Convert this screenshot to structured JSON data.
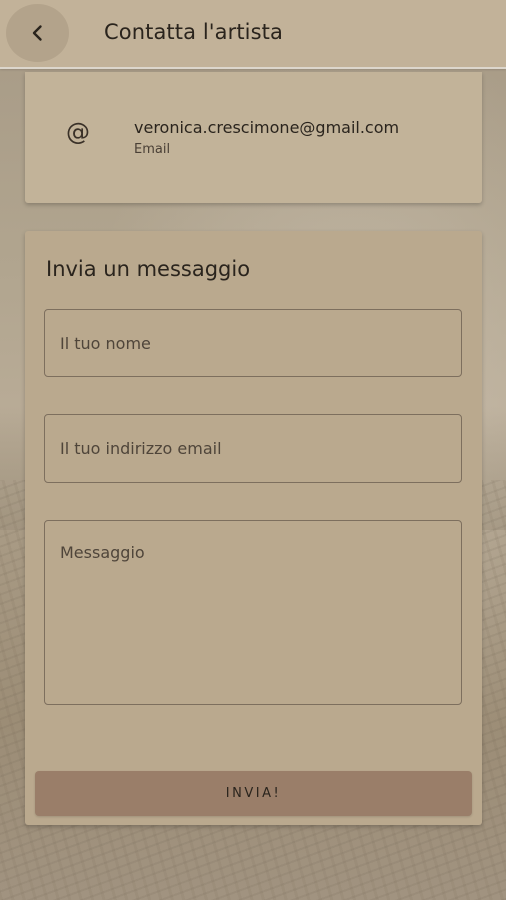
{
  "appbar": {
    "title": "Contatta l'artista",
    "back_icon": "chevron-left-icon"
  },
  "contact": {
    "icon": "at-sign-icon",
    "icon_glyph": "@",
    "email": "veronica.crescimone@gmail.com",
    "label": "Email"
  },
  "form": {
    "title": "Invia un messaggio",
    "name_placeholder": "Il tuo nome",
    "email_placeholder": "Il tuo indirizzo email",
    "message_placeholder": "Messaggio",
    "submit_label": "INVIA!"
  },
  "colors": {
    "appbar": "#c2b299",
    "card": "#c2b399",
    "button": "#9a7e69",
    "text": "#2a241d"
  }
}
